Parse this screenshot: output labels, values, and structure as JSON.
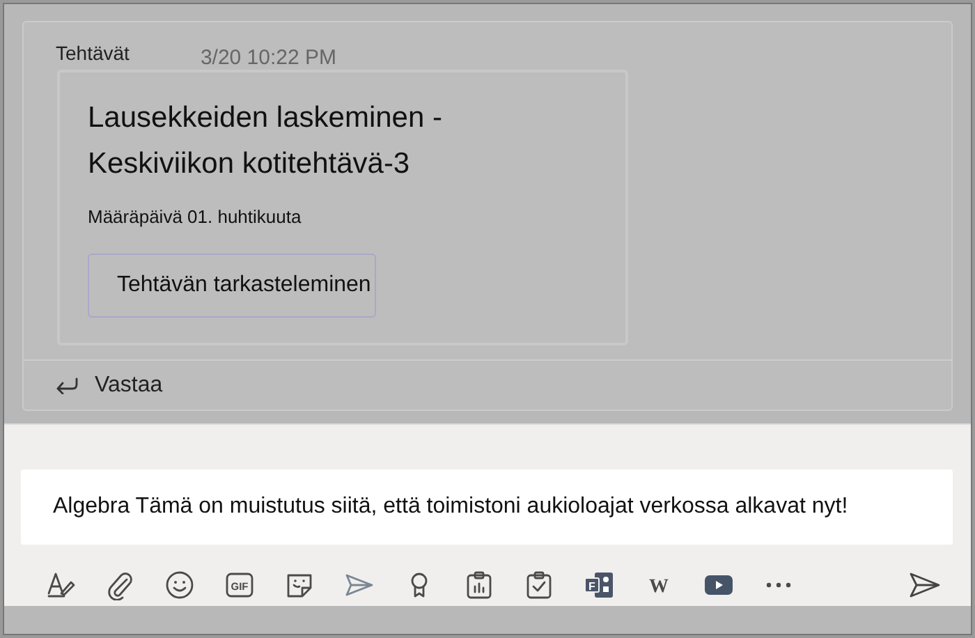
{
  "message": {
    "sender": "Tehtävät",
    "time": "3/20 10:22 PM",
    "card": {
      "title_lines": [
        "Lausekkeiden laskeminen -",
        "Keskiviikon kotitehtävä-3"
      ],
      "due": "Määräpäivä 01. huhtikuuta",
      "button": "Tehtävän tarkasteleminen"
    },
    "reply": "Vastaa"
  },
  "compose": {
    "text": "Algebra Tämä on muistutus siitä, että toimistoni aukioloajat verkossa alkavat nyt!",
    "toolbar": [
      {
        "kind": "format"
      },
      {
        "kind": "attach"
      },
      {
        "kind": "emoji"
      },
      {
        "kind": "gif",
        "label": "GIF"
      },
      {
        "kind": "sticker"
      },
      {
        "kind": "share"
      },
      {
        "kind": "praise"
      },
      {
        "kind": "poll"
      },
      {
        "kind": "approval"
      },
      {
        "kind": "forms",
        "label": "F"
      },
      {
        "kind": "wiki",
        "label": "W"
      },
      {
        "kind": "video"
      },
      {
        "kind": "more"
      }
    ]
  }
}
